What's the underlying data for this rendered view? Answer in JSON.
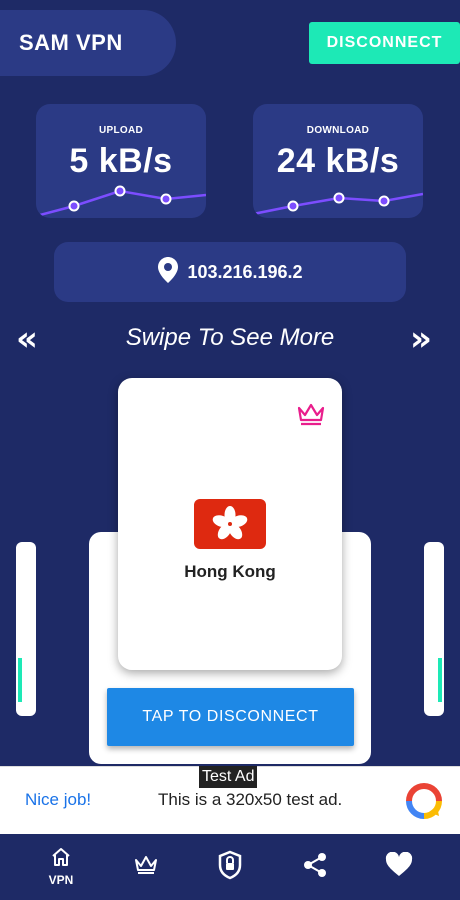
{
  "app": {
    "title": "SAM VPN"
  },
  "header": {
    "disconnect_label": "DISCONNECT"
  },
  "stats": {
    "upload": {
      "label": "UPLOAD",
      "value": "5 kB/s"
    },
    "download": {
      "label": "DOWNLOAD",
      "value": "24 kB/s"
    }
  },
  "ip": {
    "address": "103.216.196.2"
  },
  "carousel": {
    "hint": "Swipe To See More",
    "prev_glyph": "«",
    "next_glyph": "»",
    "current_country": "Hong Kong",
    "premium_icon": "crown-icon",
    "accent_color": "#1de9b6"
  },
  "action": {
    "tap_label": "TAP TO DISCONNECT"
  },
  "ad": {
    "tag": "Test Ad",
    "headline": "Nice job!",
    "body": "This is a 320x50 test ad."
  },
  "nav": {
    "items": [
      {
        "icon": "home-icon",
        "label": "VPN"
      },
      {
        "icon": "crown-icon",
        "label": ""
      },
      {
        "icon": "shield-lock-icon",
        "label": ""
      },
      {
        "icon": "share-icon",
        "label": ""
      },
      {
        "icon": "heart-icon",
        "label": ""
      }
    ]
  },
  "colors": {
    "background": "#1e2a66",
    "card": "#2b3a85",
    "accent": "#1de9b6",
    "button_blue": "#1e88e5",
    "crown_pink": "#e91e8c",
    "graph_line": "#7c4dff"
  }
}
